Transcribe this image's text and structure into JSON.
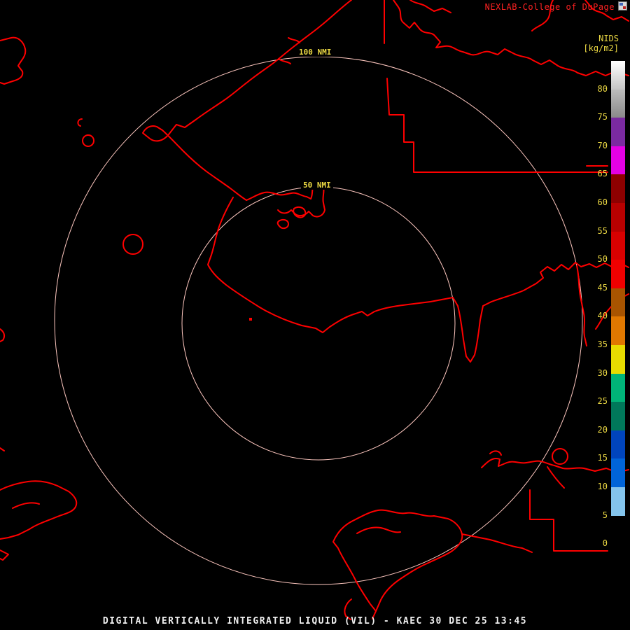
{
  "header": {
    "brand": "NEXLAB-College of DuPage"
  },
  "colorbar": {
    "title": "NIDS",
    "units": "[kg/m2]",
    "segments": [
      {
        "label": "80",
        "c1": "#ffffff",
        "c2": "#c4c4c4"
      },
      {
        "label": "75",
        "c1": "#bcbcbc",
        "c2": "#8a8a8a"
      },
      {
        "label": "70",
        "c1": "#7a2aa0"
      },
      {
        "label": "65",
        "c1": "#e400e4"
      },
      {
        "label": "60",
        "c1": "#8e0000"
      },
      {
        "label": "55",
        "c1": "#b80000"
      },
      {
        "label": "50",
        "c1": "#d80000"
      },
      {
        "label": "45",
        "c1": "#f00000"
      },
      {
        "label": "40",
        "c1": "#a85400"
      },
      {
        "label": "35",
        "c1": "#e07800"
      },
      {
        "label": "30",
        "c1": "#e8dc00"
      },
      {
        "label": "25",
        "c1": "#00b478"
      },
      {
        "label": "20",
        "c1": "#00785a"
      },
      {
        "label": "15",
        "c1": "#0044bc"
      },
      {
        "label": "10",
        "c1": "#0064d8"
      },
      {
        "label": "5",
        "c1": "#84c4ec"
      },
      {
        "label": "0",
        "c1": "#000000"
      }
    ]
  },
  "rings": [
    {
      "label": "100 NMI"
    },
    {
      "label": "50 NMI"
    }
  ],
  "footer": "DIGITAL VERTICALLY INTEGRATED LIQUID (VIL) - KAEC 30 DEC 25 13:45",
  "colors": {
    "background": "#000000",
    "map_outline": "#ff0000",
    "ring": "#ffc8c0",
    "label_yellow": "#ecd943",
    "header_red": "#ff2222",
    "footer_white": "#f0f0f0"
  }
}
